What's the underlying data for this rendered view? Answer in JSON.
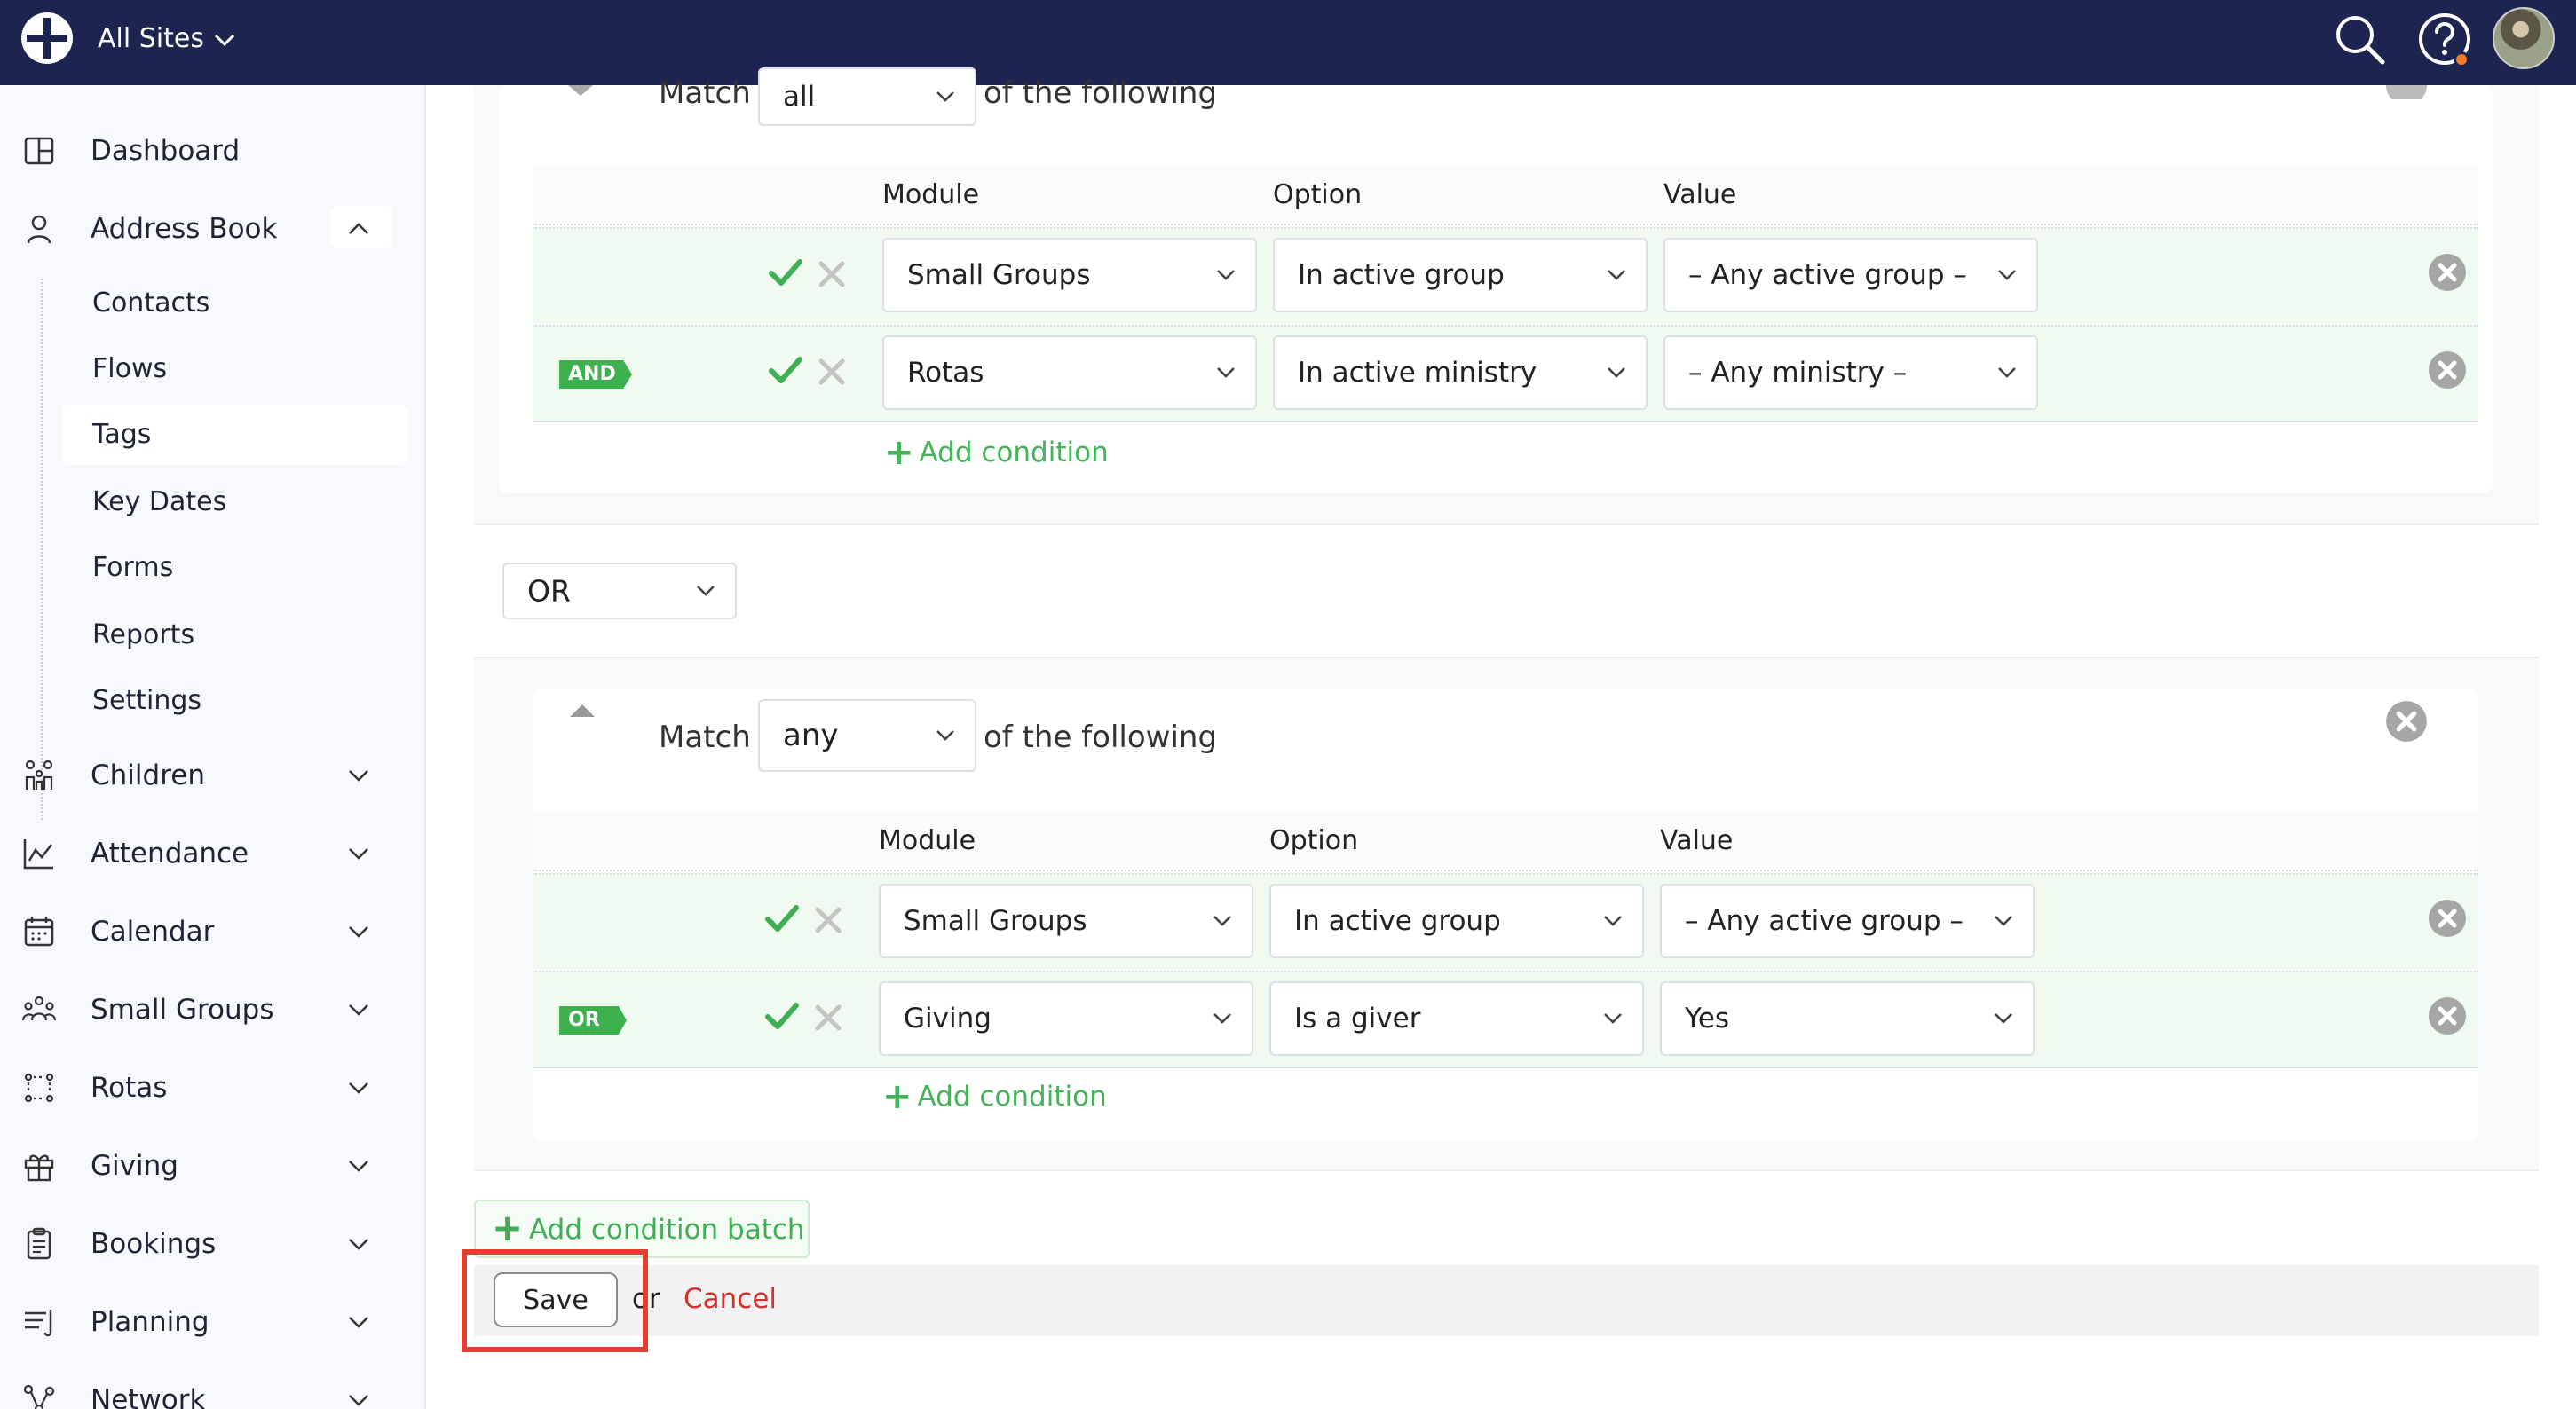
{
  "topbar": {
    "site_selector": "All Sites",
    "icons": [
      "logo-icon",
      "chevron-down-icon",
      "search-icon",
      "help-icon",
      "avatar"
    ]
  },
  "sidebar": {
    "items": [
      {
        "label": "Dashboard",
        "icon": "dashboard-icon"
      },
      {
        "label": "Address Book",
        "icon": "person-icon",
        "expanded": true
      },
      {
        "label": "Children",
        "icon": "children-icon"
      },
      {
        "label": "Attendance",
        "icon": "chart-icon"
      },
      {
        "label": "Calendar",
        "icon": "calendar-icon"
      },
      {
        "label": "Small Groups",
        "icon": "group-icon"
      },
      {
        "label": "Rotas",
        "icon": "rota-icon"
      },
      {
        "label": "Giving",
        "icon": "gift-icon"
      },
      {
        "label": "Bookings",
        "icon": "clipboard-icon"
      },
      {
        "label": "Planning",
        "icon": "planning-icon"
      },
      {
        "label": "Network",
        "icon": "network-icon"
      }
    ],
    "address_book_sub": [
      {
        "label": "Contacts"
      },
      {
        "label": "Flows"
      },
      {
        "label": "Tags",
        "active": true
      },
      {
        "label": "Key Dates"
      },
      {
        "label": "Forms"
      },
      {
        "label": "Reports"
      },
      {
        "label": "Settings"
      }
    ]
  },
  "batch1": {
    "match_label": "Match",
    "match_value": "all",
    "following_label": "of the following",
    "headers": {
      "module": "Module",
      "option": "Option",
      "value": "Value"
    },
    "rows": [
      {
        "tag": "",
        "module": "Small Groups",
        "option": "In active group",
        "value": "– Any active group –"
      },
      {
        "tag": "AND",
        "module": "Rotas",
        "option": "In active ministry",
        "value": "– Any ministry –"
      }
    ],
    "add_condition": "Add condition"
  },
  "batch_join": "OR",
  "batch2": {
    "match_label": "Match",
    "match_value": "any",
    "following_label": "of the following",
    "headers": {
      "module": "Module",
      "option": "Option",
      "value": "Value"
    },
    "rows": [
      {
        "tag": "",
        "module": "Small Groups",
        "option": "In active group",
        "value": "– Any active group –"
      },
      {
        "tag": "OR",
        "module": "Giving",
        "option": "Is a giver",
        "value": "Yes"
      }
    ],
    "add_condition": "Add condition"
  },
  "actions": {
    "add_batch": "Add condition batch",
    "save": "Save",
    "or": "or",
    "cancel": "Cancel"
  },
  "colors": {
    "topbar": "#1e2450",
    "green": "#45b35a",
    "tag_green": "#3db14e",
    "cancel_red": "#d0322d",
    "highlight": "#e0402f"
  }
}
